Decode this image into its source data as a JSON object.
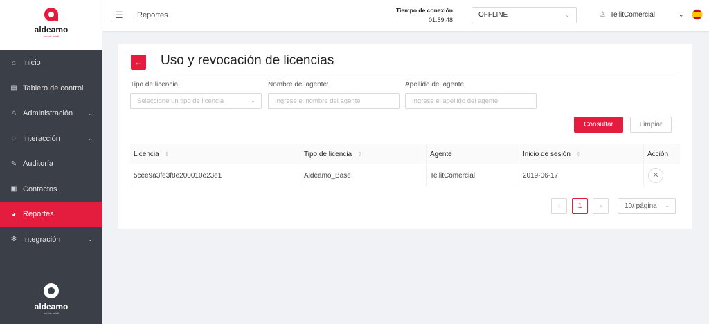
{
  "brand": {
    "name": "aldeamo",
    "tagline": "tu vida móvil",
    "accent": "#e41c3d",
    "sidebar_bg": "#3a3f48"
  },
  "sidebar": {
    "items": [
      {
        "label": "Inicio",
        "icon": "home-icon",
        "glyph": "⌂",
        "has_submenu": false
      },
      {
        "label": "Tablero de control",
        "icon": "dashboard-icon",
        "glyph": "▤",
        "has_submenu": false
      },
      {
        "label": "Administración",
        "icon": "admin-icon",
        "glyph": "♙",
        "has_submenu": true
      },
      {
        "label": "Interacción",
        "icon": "chat-icon",
        "glyph": "◌",
        "has_submenu": true
      },
      {
        "label": "Auditoría",
        "icon": "audit-icon",
        "glyph": "✎",
        "has_submenu": false
      },
      {
        "label": "Contactos",
        "icon": "contacts-icon",
        "glyph": "▣",
        "has_submenu": false
      },
      {
        "label": "Reportes",
        "icon": "reports-icon",
        "glyph": "◕",
        "has_submenu": false,
        "active": true
      },
      {
        "label": "Integración",
        "icon": "integration-icon",
        "glyph": "✻",
        "has_submenu": true
      }
    ]
  },
  "header": {
    "breadcrumb": "Reportes",
    "connection_label": "Tiempo de conexión",
    "connection_time": "01:59:48",
    "status": "OFFLINE",
    "user": "TellitComercial"
  },
  "page": {
    "title": "Uso y revocación de licencias",
    "filters": {
      "license_type_label": "Tipo de licencia:",
      "license_type_placeholder": "Seleccione un tipo de licencia",
      "agent_name_label": "Nombre del agente:",
      "agent_name_placeholder": "Ingrese el nombre del agente",
      "agent_lastname_label": "Apellido del agente:",
      "agent_lastname_placeholder": "Ingrese el apellido del agente"
    },
    "buttons": {
      "consultar": "Consultar",
      "limpiar": "Limpiar"
    },
    "table": {
      "columns": [
        "Licencia",
        "Tipo de licencia",
        "Agente",
        "Inicio de sesión",
        "Acción"
      ],
      "rows": [
        {
          "licencia": "5cee9a3fe3f8e200010e23e1",
          "tipo": "Aldeamo_Base",
          "agente": "TellitComercial",
          "inicio": "2019-06-17"
        }
      ]
    },
    "pagination": {
      "current_page": "1",
      "page_size": "10/ página"
    }
  }
}
